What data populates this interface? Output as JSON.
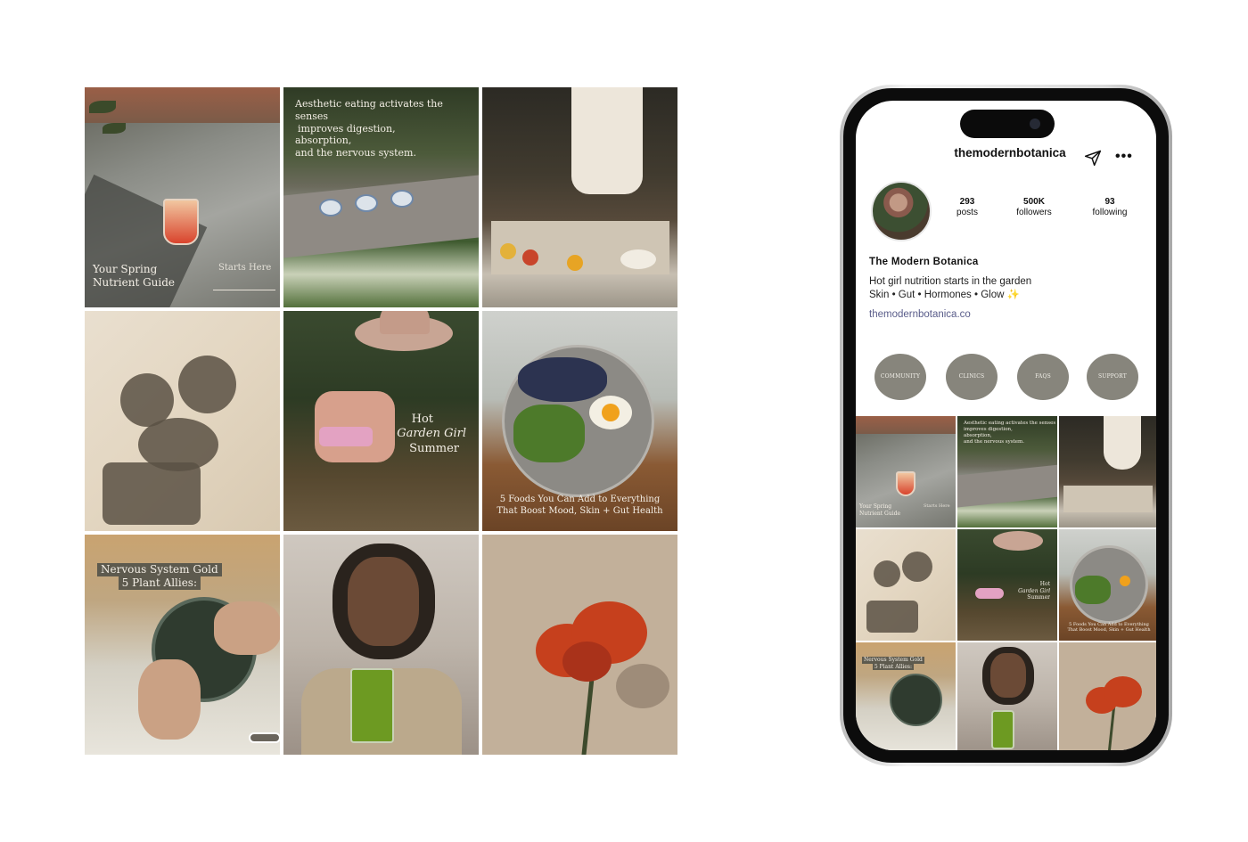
{
  "feed": {
    "tiles": [
      {
        "caption_lines": [
          "Your Spring",
          "Nutrient Guide"
        ],
        "side_text": "Starts Here"
      },
      {
        "caption_lines": [
          "Aesthetic eating activates the senses",
          "improves digestion,",
          "absorption,",
          "and the nervous system."
        ]
      },
      {
        "caption_lines": []
      },
      {
        "caption_lines": []
      },
      {
        "caption_lines": [
          "Hot",
          "Garden Girl",
          "Summer"
        ]
      },
      {
        "caption_lines": [
          "5 Foods You Can Add to Everything",
          "That Boost Mood, Skin + Gut Health"
        ]
      },
      {
        "caption_lines": [
          "Nervous System Gold",
          "5 Plant Allies:"
        ]
      },
      {
        "caption_lines": []
      },
      {
        "caption_lines": []
      }
    ]
  },
  "profile": {
    "username": "themodernbotanica",
    "send_icon": "send-icon",
    "more_icon": "more-icon",
    "more_glyph": "•••",
    "stats": {
      "posts": {
        "value": "293",
        "label": "posts"
      },
      "followers": {
        "value": "500K",
        "label": "followers"
      },
      "following": {
        "value": "93",
        "label": "following"
      }
    },
    "display_name": "The Modern Botanica",
    "bio_line1": "Hot girl nutrition starts in the garden",
    "bio_line2": "Skin • Gut • Hormones • Glow",
    "bio_emoji": "✨",
    "link": "themodernbotanica.co",
    "highlights": [
      "COMMUNITY",
      "CLINICS",
      "FAQS",
      "SUPPORT"
    ],
    "highlight_color": "#87857c",
    "link_color": "#5a5d8a"
  }
}
